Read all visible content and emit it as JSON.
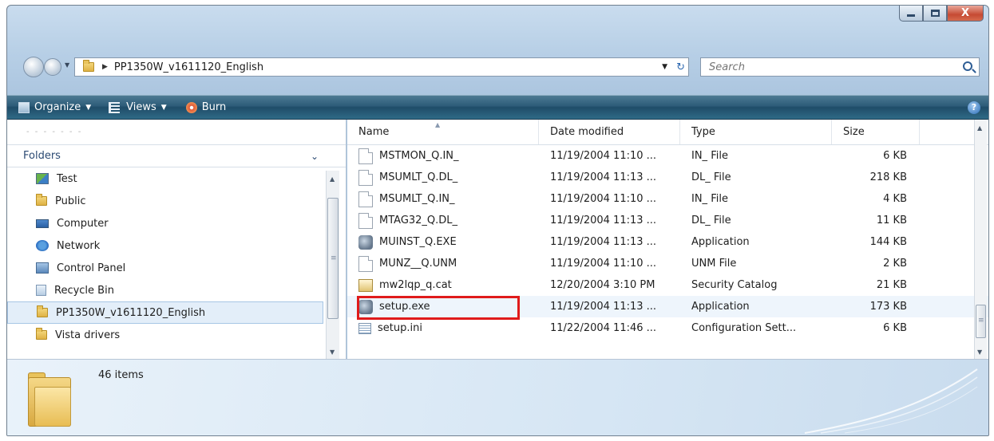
{
  "window": {
    "caption": {
      "min": "min",
      "max": "max",
      "close": "X"
    }
  },
  "address": {
    "path": "PP1350W_v1611120_English",
    "search_placeholder": "Search"
  },
  "toolbar": {
    "organize": "Organize",
    "views": "Views",
    "burn": "Burn",
    "help": "?"
  },
  "sidebar": {
    "favorites_placeholder": "- - - - - - -",
    "folders_header": "Folders",
    "items": [
      {
        "label": "Test",
        "icon": "test-icon"
      },
      {
        "label": "Public",
        "icon": "folder-icon"
      },
      {
        "label": "Computer",
        "icon": "computer-icon"
      },
      {
        "label": "Network",
        "icon": "network-icon"
      },
      {
        "label": "Control Panel",
        "icon": "control-panel-icon"
      },
      {
        "label": "Recycle Bin",
        "icon": "recycle-bin-icon"
      },
      {
        "label": "PP1350W_v1611120_English",
        "icon": "folder-icon",
        "selected": true
      },
      {
        "label": "Vista drivers",
        "icon": "folder-icon"
      }
    ]
  },
  "files": {
    "columns": [
      "Name",
      "Date modified",
      "Type",
      "Size"
    ],
    "rows": [
      {
        "name": "MSTMON_Q.IN_",
        "date": "11/19/2004 11:10 ...",
        "type": "IN_ File",
        "size": "6 KB",
        "icon": "file-icon"
      },
      {
        "name": "MSUMLT_Q.DL_",
        "date": "11/19/2004 11:13 ...",
        "type": "DL_ File",
        "size": "218 KB",
        "icon": "file-icon"
      },
      {
        "name": "MSUMLT_Q.IN_",
        "date": "11/19/2004 11:10 ...",
        "type": "IN_ File",
        "size": "4 KB",
        "icon": "file-icon"
      },
      {
        "name": "MTAG32_Q.DL_",
        "date": "11/19/2004 11:13 ...",
        "type": "DL_ File",
        "size": "11 KB",
        "icon": "file-icon"
      },
      {
        "name": "MUINST_Q.EXE",
        "date": "11/19/2004 11:13 ...",
        "type": "Application",
        "size": "144 KB",
        "icon": "application-icon"
      },
      {
        "name": "MUNZ__Q.UNM",
        "date": "11/19/2004 11:10 ...",
        "type": "UNM File",
        "size": "2 KB",
        "icon": "file-icon"
      },
      {
        "name": "mw2lqp_q.cat",
        "date": "12/20/2004 3:10 PM",
        "type": "Security Catalog",
        "size": "21 KB",
        "icon": "security-catalog-icon"
      },
      {
        "name": "setup.exe",
        "date": "11/19/2004 11:13 ...",
        "type": "Application",
        "size": "173 KB",
        "icon": "setup-application-icon",
        "highlighted": true
      },
      {
        "name": "setup.ini",
        "date": "11/22/2004 11:46 ...",
        "type": "Configuration Sett...",
        "size": "6 KB",
        "icon": "configuration-file-icon"
      }
    ]
  },
  "details": {
    "count": "46 items"
  },
  "colors": {
    "highlight_border": "#e01b1b",
    "command_bar": "#2c5b78",
    "selected_row": "#e3eef9"
  }
}
